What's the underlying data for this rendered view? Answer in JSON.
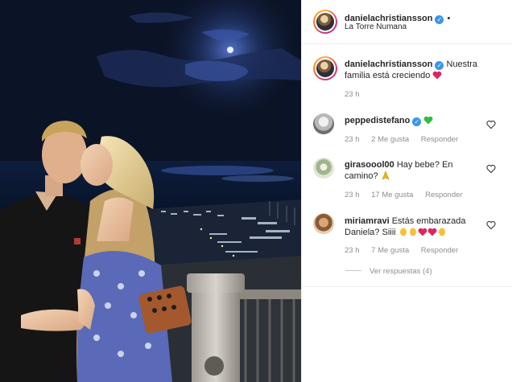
{
  "post": {
    "username": "danielachristiansson",
    "dot": "•",
    "location": "La Torre Numana",
    "caption": {
      "username": "danielachristiansson",
      "text_line1": "Nuestra",
      "text_line2": "familia está creciendo",
      "time": "23 h"
    }
  },
  "comments": [
    {
      "username": "peppedistefano",
      "text": "",
      "time": "23 h",
      "likes": "2 Me gusta",
      "reply": "Responder"
    },
    {
      "username": "girasoool00",
      "text_line1": "Hay bebe? En",
      "text_line2": "camino?",
      "time": "23 h",
      "likes": "17 Me gusta",
      "reply": "Responder"
    },
    {
      "username": "miriamravi",
      "text_line1": "Estás embarazada",
      "text_line2": "Daniela? Siiii",
      "time": "23 h",
      "likes": "7 Me gusta",
      "reply": "Responder"
    }
  ],
  "view_replies": "Ver respuestas (4)",
  "icons": {
    "verified": "verified-badge-icon",
    "heart": "heart-outline-icon",
    "red_heart": "red-heart-emoji",
    "green_heart": "green-heart-emoji",
    "clap": "clapping-hands-emoji",
    "praying": "pray-emoji"
  },
  "colors": {
    "verified": "#3897f0",
    "meta": "#8e8e8e",
    "text": "#262626",
    "red_heart": "#e0245e",
    "green_heart": "#2fbf3a"
  }
}
